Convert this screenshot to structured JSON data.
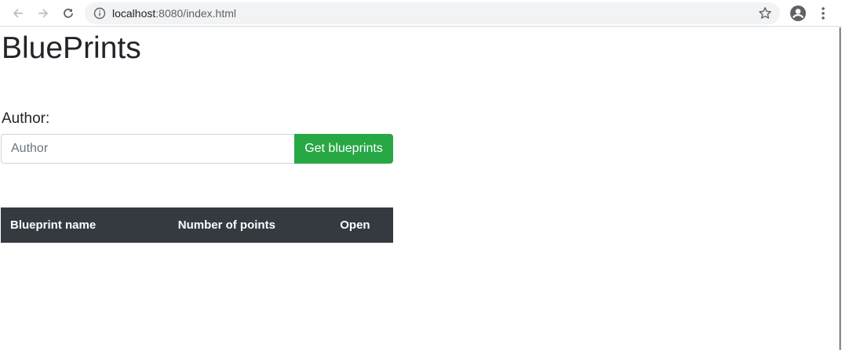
{
  "browser": {
    "url_host": "localhost",
    "url_path": ":8080/index.html",
    "icons": {
      "back": "back-arrow-icon",
      "forward": "forward-arrow-icon",
      "reload": "reload-icon",
      "info": "info-icon",
      "bookmark": "star-icon",
      "profile": "profile-icon",
      "menu": "kebab-menu-icon"
    }
  },
  "page": {
    "title": "BluePrints",
    "author_label": "Author:",
    "author_input": {
      "value": "",
      "placeholder": "Author"
    },
    "get_button_label": "Get blueprints",
    "table": {
      "headers": [
        "Blueprint name",
        "Number of points",
        "Open"
      ],
      "rows": []
    }
  },
  "colors": {
    "button_green": "#28a745",
    "table_header_bg": "#343a40",
    "text_dark": "#212529"
  }
}
